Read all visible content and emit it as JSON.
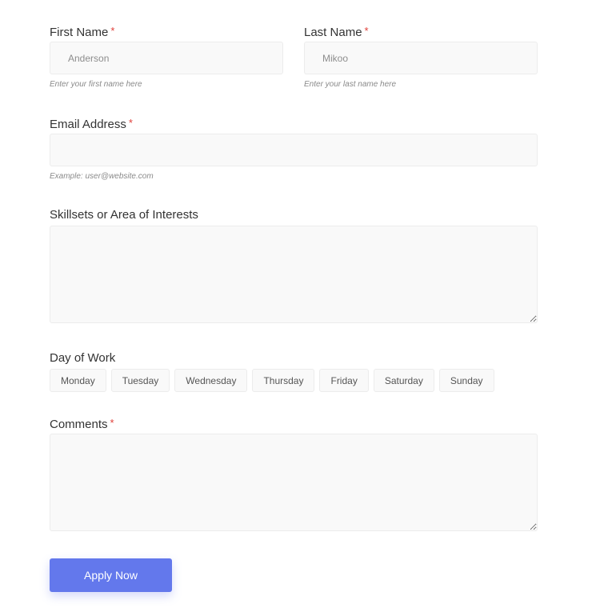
{
  "form": {
    "first_name": {
      "label": "First Name",
      "required_mark": "*",
      "value": "",
      "placeholder": "Anderson",
      "help": "Enter your first name here"
    },
    "last_name": {
      "label": "Last Name",
      "required_mark": "*",
      "value": "",
      "placeholder": "Mikoo",
      "help": "Enter your last name here"
    },
    "email": {
      "label": "Email Address",
      "required_mark": "*",
      "value": "",
      "placeholder": "",
      "help": "Example: user@website.com"
    },
    "skills": {
      "label": "Skillsets or Area of Interests",
      "value": ""
    },
    "days": {
      "label": "Day of Work",
      "options": [
        "Monday",
        "Tuesday",
        "Wednesday",
        "Thursday",
        "Friday",
        "Saturday",
        "Sunday"
      ]
    },
    "comments": {
      "label": "Comments",
      "required_mark": "*",
      "value": ""
    },
    "submit_label": "Apply Now"
  },
  "colors": {
    "accent": "#6378ec",
    "required": "#e0403a",
    "field_bg": "#f9f9f9"
  }
}
